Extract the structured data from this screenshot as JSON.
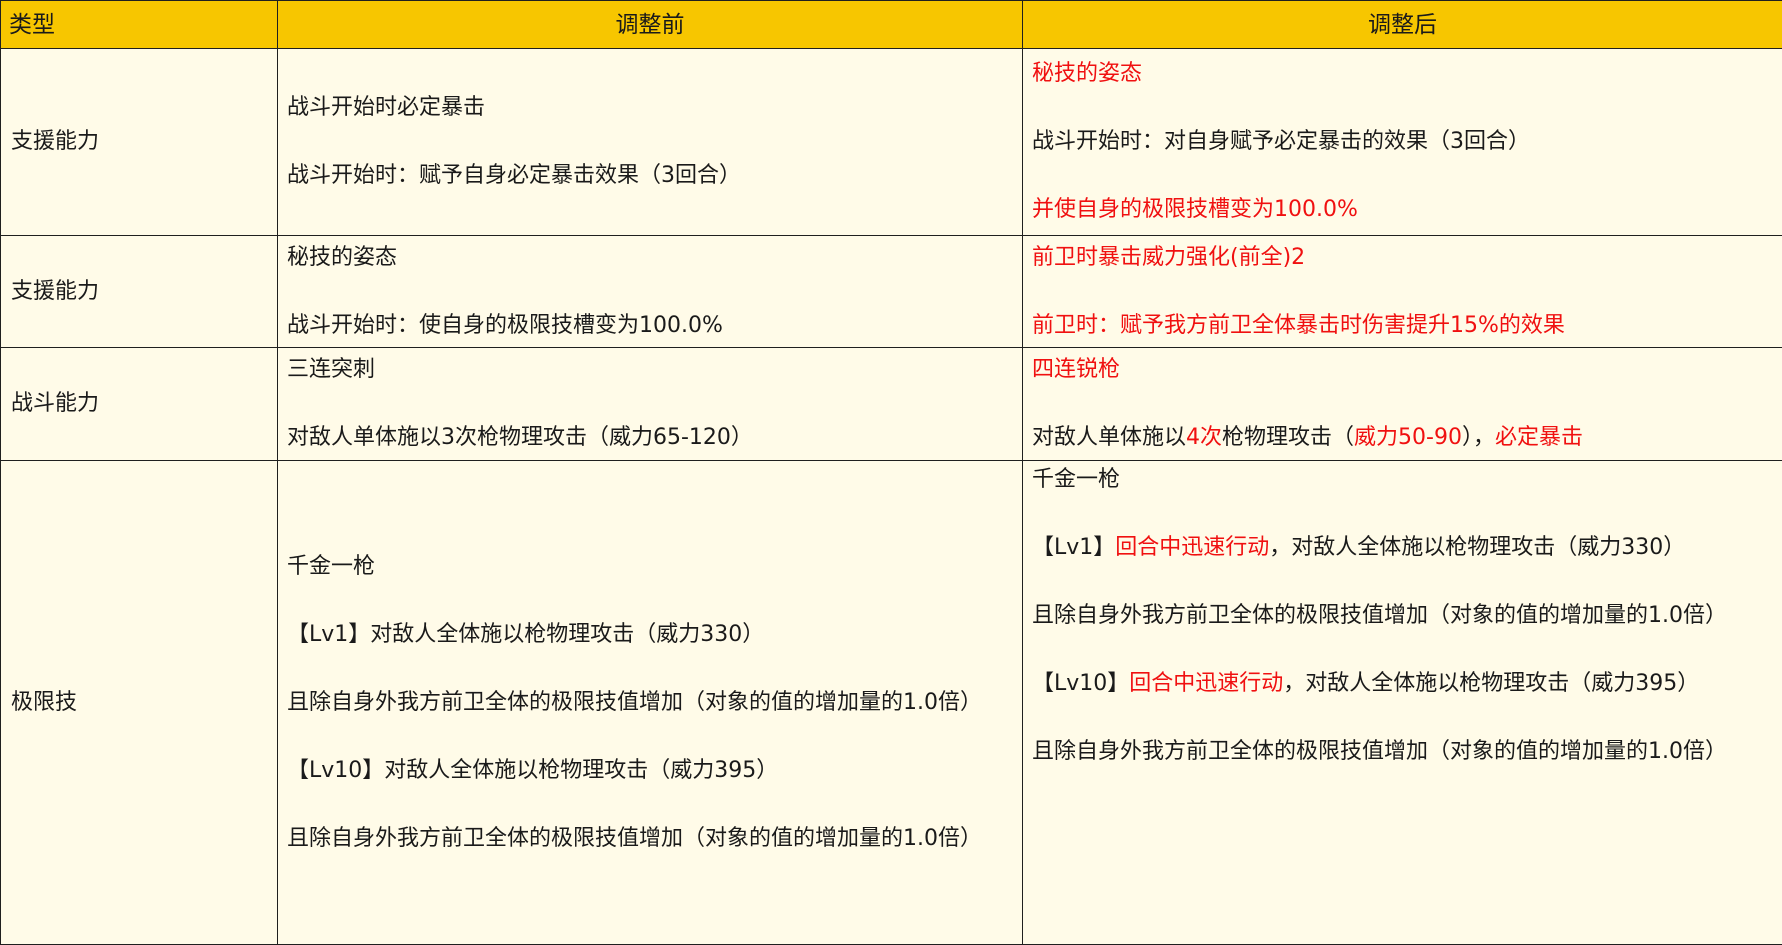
{
  "header": {
    "type": "类型",
    "before": "调整前",
    "after": "调整后"
  },
  "rows": [
    {
      "type": "支援能力",
      "before": [
        "战斗开始时必定暴击",
        "战斗开始时：赋予自身必定暴击效果（3回合）"
      ],
      "after": {
        "title": "秘技的姿态",
        "line1": "战斗开始时：对自身赋予必定暴击的效果（3回合）",
        "line2": "并使自身的极限技槽变为100.0%"
      }
    },
    {
      "type": "支援能力",
      "before": [
        "秘技的姿态",
        "战斗开始时：使自身的极限技槽变为100.0%"
      ],
      "after": {
        "title": "前卫时暴击威力强化(前全)2",
        "line1": "前卫时：赋予我方前卫全体暴击时伤害提升15%的效果"
      }
    },
    {
      "type": "战斗能力",
      "before": [
        "三连突刺",
        "对敌人单体施以3次枪物理攻击（威力65-120）"
      ],
      "after": {
        "title": "四连锐枪",
        "p1": "对敌人单体施以",
        "p2": "4次",
        "p3": "枪物理攻击（",
        "p4": "威力50-90",
        "p5": "），",
        "p6": "必定暴击"
      }
    },
    {
      "type": "极限技",
      "before": [
        "千金一枪",
        "【Lv1】对敌人全体施以枪物理攻击（威力330）",
        "且除自身外我方前卫全体的极限技值增加（对象的值的增加量的1.0倍）",
        "【Lv10】对敌人全体施以枪物理攻击（威力395）",
        "且除自身外我方前卫全体的极限技值增加（对象的值的增加量的1.0倍）"
      ],
      "after": {
        "title": "千金一枪",
        "lv1_a": "【Lv1】",
        "lv1_b": "回合中迅速行动",
        "lv1_c": "，对敌人全体施以枪物理攻击（威力330）",
        "gain1": "且除自身外我方前卫全体的极限技值增加（对象的值的增加量的1.0倍）",
        "lv10_a": "【Lv10】",
        "lv10_b": "回合中迅速行动",
        "lv10_c": "，对敌人全体施以枪物理攻击（威力395）",
        "gain2": "且除自身外我方前卫全体的极限技值增加（对象的值的增加量的1.0倍）"
      }
    }
  ],
  "colors": {
    "header_bg": "#f7c600",
    "cell_bg": "#fffbe8",
    "highlight": "#f01010"
  }
}
